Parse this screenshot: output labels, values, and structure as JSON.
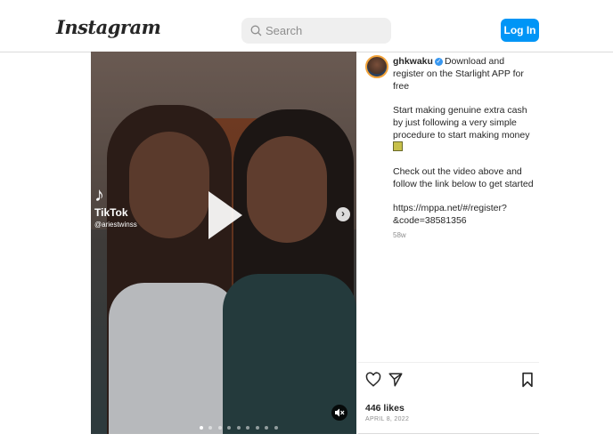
{
  "header": {
    "logo_text": "Instagram",
    "search_placeholder": "Search",
    "login_label": "Log In"
  },
  "media": {
    "tiktok_brand": "TikTok",
    "tiktok_user": "@ariestwinss",
    "slide_count": 9,
    "active_slide": 1
  },
  "post": {
    "username": "ghkwaku",
    "caption_line1": "Download and register on the Starlight APP for free",
    "caption_para2": "Start making genuine extra cash by just following a very simple procedure to start making money",
    "caption_para3": "Check out the video above and follow the link below to get started",
    "caption_link_line1": "https://mppa.net/#/register?",
    "caption_link_line2": "&code=38581356",
    "time_ago": "58w",
    "likes": "446 likes",
    "date": "APRIL 8, 2022"
  },
  "colors": {
    "accent": "#0095f6",
    "verified": "#3897f0"
  }
}
